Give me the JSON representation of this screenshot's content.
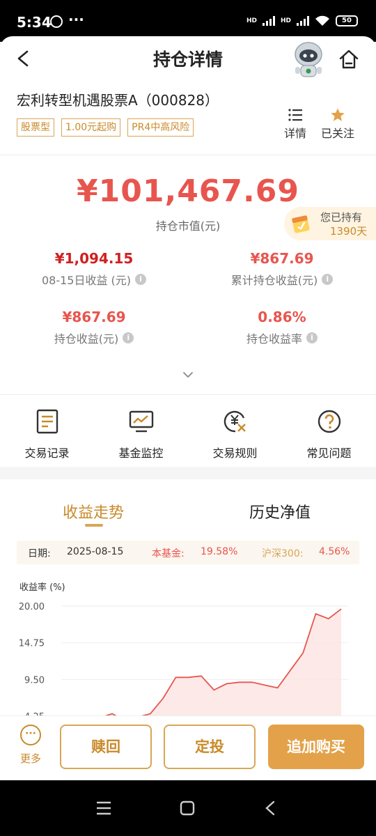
{
  "status_bar": {
    "time": "5:34",
    "dots": "···",
    "hd1": "HD",
    "hd2": "HD",
    "battery": "50"
  },
  "header": {
    "title": "持仓详情",
    "fund_name": "宏利转型机遇股票A（000828）",
    "tags": [
      "股票型",
      "1.00元起购",
      "PR4中高风险"
    ],
    "detail_label": "详情",
    "follow_label": "已关注",
    "accent_color": "#c98a2a"
  },
  "summary": {
    "market_value": "¥101,467.69",
    "market_value_label": "持仓市值(元)",
    "held_label": "您已持有",
    "held_days": "1390天",
    "metrics": [
      {
        "value": "¥1,094.15",
        "label": "08-15日收益 (元)"
      },
      {
        "value": "¥867.69",
        "label": "累计持仓收益(元)"
      },
      {
        "value": "¥867.69",
        "label": "持仓收益(元)"
      },
      {
        "value": "0.86%",
        "label": "持仓收益率"
      }
    ]
  },
  "quick_actions": [
    {
      "label": "交易记录",
      "icon": "document-icon"
    },
    {
      "label": "基金监控",
      "icon": "monitor-chart-icon"
    },
    {
      "label": "交易规则",
      "icon": "yuan-rules-icon"
    },
    {
      "label": "常见问题",
      "icon": "question-icon"
    }
  ],
  "trend": {
    "tab_active": "收益走势",
    "tab_other": "历史净值",
    "date_label": "日期:",
    "date_value": "2025-08-15",
    "fund_label": "本基金:",
    "fund_value": "19.58%",
    "index_label": "沪深300:",
    "index_value": "4.56%",
    "ylabel": "收益率 (%)"
  },
  "chart_data": {
    "type": "area",
    "ylabel": "收益率 (%)",
    "y_ticks": [
      "20.00",
      "14.75",
      "9.50",
      "4.25"
    ],
    "ylim": [
      4.25,
      20.0
    ],
    "series": [
      {
        "name": "本基金",
        "values": [
          3.0,
          3.3,
          3.6,
          4.0,
          4.6,
          3.6,
          4.1,
          4.6,
          6.8,
          9.8,
          9.8,
          10.0,
          8.0,
          8.9,
          9.1,
          9.1,
          8.7,
          8.3,
          10.8,
          13.3,
          18.9,
          18.2,
          19.58
        ]
      }
    ],
    "grid": true,
    "color": "#e8554e"
  },
  "bottom_bar": {
    "more_label": "更多",
    "redeem": "赎回",
    "sip": "定投",
    "buy": "追加购买"
  }
}
